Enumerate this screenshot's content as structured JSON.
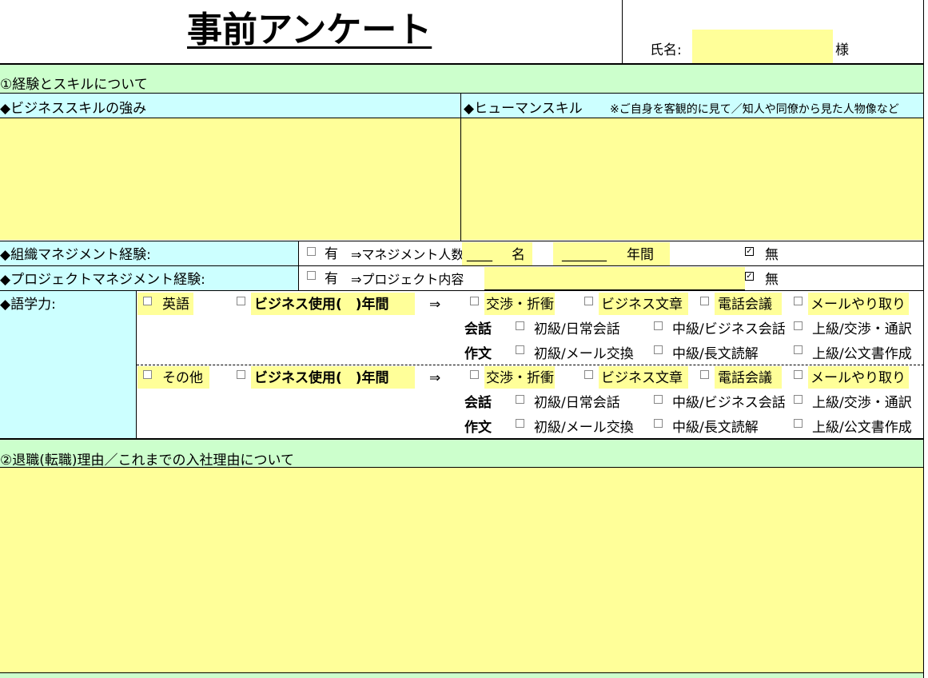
{
  "title": "事前アンケート",
  "name": {
    "label": "氏名:",
    "value": "",
    "suffix": "様"
  },
  "section1": {
    "header": "①経験とスキルについて",
    "business_skill": {
      "label": "◆ビジネススキルの強み",
      "value": ""
    },
    "human_skill": {
      "label": "◆ヒューマンスキル",
      "note": "※ご自身を客観的に見て／知人や同僚から見た人物像など",
      "value": ""
    },
    "org_mgmt": {
      "label": "◆組織マネジメント経験:",
      "yes": "有",
      "arrow_text": "⇒マネジメント人数",
      "blank1": "____",
      "unit1": "名",
      "blank2": "_______",
      "unit2": "年間",
      "no": "無",
      "yes_checked": false,
      "no_checked": true
    },
    "proj_mgmt": {
      "label": "◆プロジェクトマネジメント経験:",
      "yes": "有",
      "arrow_text": "⇒プロジェクト内容",
      "no": "無",
      "yes_checked": false,
      "no_checked": true
    },
    "language": {
      "label": "◆語学力:",
      "english": "英語",
      "other": "その他",
      "business_use": "ビジネス使用(　)年間",
      "arrow": "⇒",
      "tasks": [
        "交渉・折衝",
        "ビジネス文章",
        "電話会議",
        "メールやり取り"
      ],
      "conversation_label": "会話",
      "conversation": [
        "初級/日常会話",
        "中級/ビジネス会話",
        "上級/交渉・通訳"
      ],
      "writing_label": "作文",
      "writing": [
        "初級/メール交換",
        "中級/長文読解",
        "上級/公文書作成"
      ]
    }
  },
  "section2": {
    "header": "②退職(転職)理由／これまでの入社理由について",
    "value": ""
  }
}
